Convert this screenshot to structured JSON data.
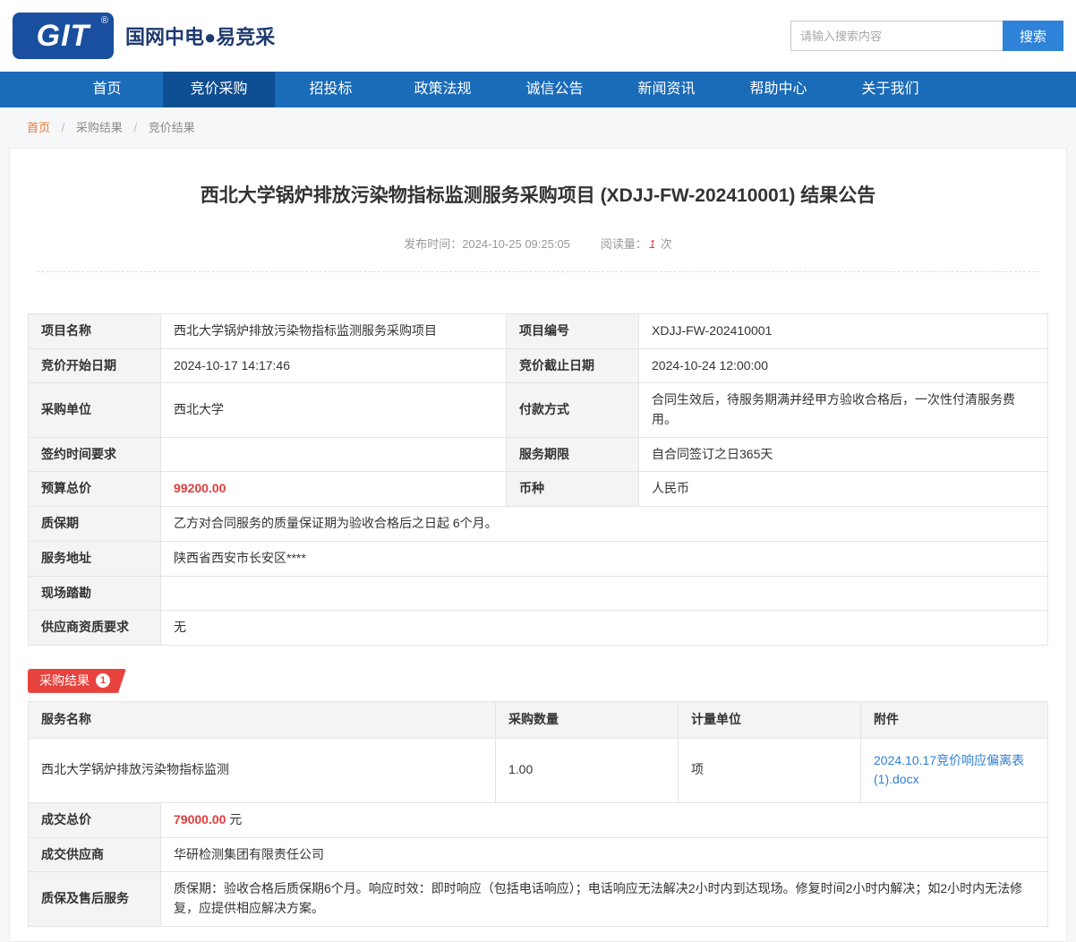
{
  "header": {
    "logo_text": "GIT",
    "logo_reg": "®",
    "site_name": "国网中电●易竞采",
    "search": {
      "placeholder": "请输入搜索内容",
      "button_label": "搜索"
    }
  },
  "nav": {
    "items": [
      {
        "label": "首页"
      },
      {
        "label": "竞价采购"
      },
      {
        "label": "招投标"
      },
      {
        "label": "政策法规"
      },
      {
        "label": "诚信公告"
      },
      {
        "label": "新闻资讯"
      },
      {
        "label": "帮助中心"
      },
      {
        "label": "关于我们"
      }
    ]
  },
  "breadcrumb": {
    "separator": "/",
    "items": [
      "首页",
      "采购结果",
      "竞价结果"
    ]
  },
  "article": {
    "title": "西北大学锅炉排放污染物指标监测服务采购项目 (XDJJ-FW-202410001) 结果公告",
    "publish_label": "发布时间：",
    "publish_time": "2024-10-25 09:25:05",
    "read_label": "阅读量：",
    "read_count": "1",
    "read_unit": "次"
  },
  "info_table": {
    "rows4": [
      {
        "l1": "项目名称",
        "v1": "西北大学锅炉排放污染物指标监测服务采购项目",
        "l2": "项目编号",
        "v2": "XDJJ-FW-202410001"
      },
      {
        "l1": "竞价开始日期",
        "v1": "2024-10-17 14:17:46",
        "l2": "竞价截止日期",
        "v2": "2024-10-24 12:00:00"
      },
      {
        "l1": "采购单位",
        "v1": "西北大学",
        "l2": "付款方式",
        "v2": "合同生效后，待服务期满并经甲方验收合格后，一次性付清服务费用。"
      },
      {
        "l1": "签约时间要求",
        "v1": "",
        "l2": "服务期限",
        "v2": "自合同签订之日365天"
      },
      {
        "l1": "预算总价",
        "v1": "99200.00",
        "l2": "币种",
        "v2": "人民币"
      }
    ],
    "rows_full": [
      {
        "label": "质保期",
        "value": "乙方对合同服务的质量保证期为验收合格后之日起 6个月。"
      },
      {
        "label": "服务地址",
        "value": "陕西省西安市长安区****"
      },
      {
        "label": "现场踏勘",
        "value": ""
      },
      {
        "label": "供应商资质要求",
        "value": "无"
      }
    ]
  },
  "result_section": {
    "badge_label": "采购结果",
    "badge_count": "1",
    "headers": [
      "服务名称",
      "采购数量",
      "计量单位",
      "附件"
    ],
    "rows": [
      {
        "service_name": "西北大学锅炉排放污染物指标监测",
        "quantity": "1.00",
        "unit": "项",
        "attachment": "2024.10.17竞价响应偏离表(1).docx"
      }
    ],
    "deal_price_label": "成交总价",
    "deal_price": "79000.00",
    "deal_price_unit": "元",
    "supplier_label": "成交供应商",
    "supplier": "华研检测集团有限责任公司",
    "warranty_label": "质保及售后服务",
    "warranty": "质保期：验收合格后质保期6个月。响应时效：即时响应（包括电话响应）；电话响应无法解决2小时内到达现场。修复时间2小时内解决；如2小时内无法修复，应提供相应解决方案。"
  }
}
